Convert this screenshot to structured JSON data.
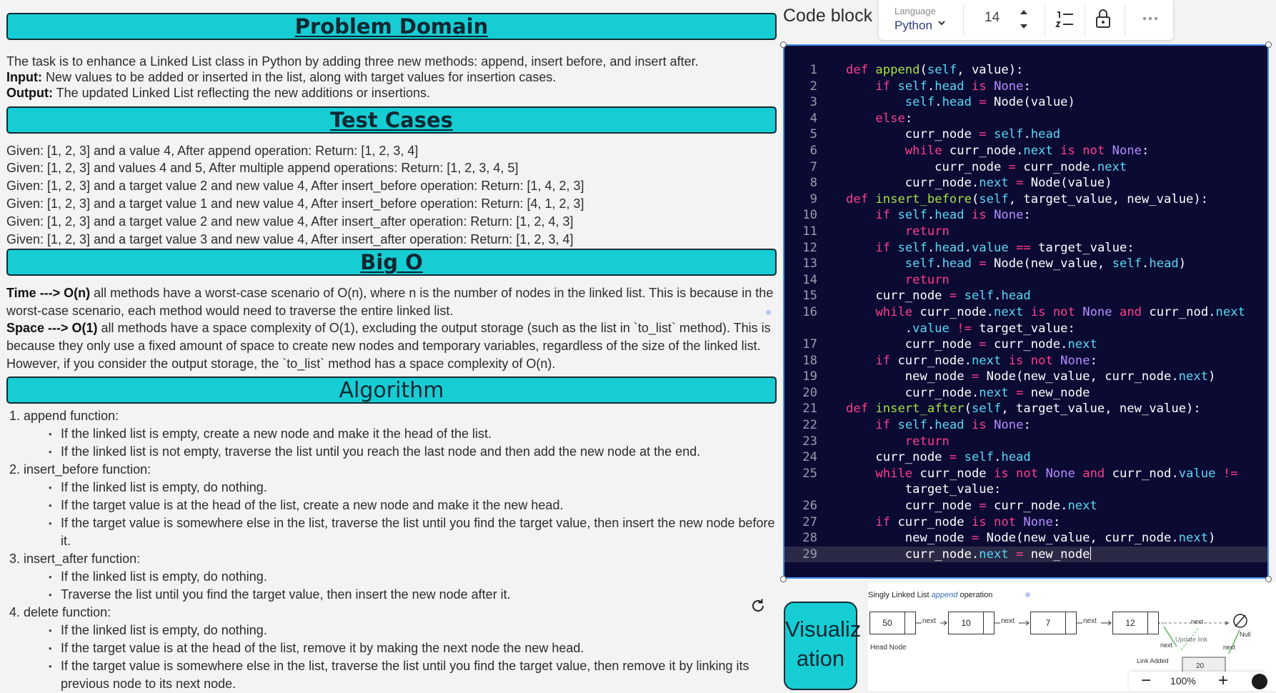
{
  "sections": {
    "problem_domain": {
      "title": "Problem Domain",
      "description": "The task is to enhance a Linked List class in Python by adding three new methods: append, insert before, and insert after.",
      "input_label": "Input:",
      "input_text": " New values to be added or inserted in the list, along with target values for insertion cases.",
      "output_label": "Output:",
      "output_text": " The updated Linked List reflecting the new additions or insertions."
    },
    "test_cases": {
      "title": "Test Cases",
      "items": [
        "Given: [1, 2, 3] and a value 4, After append operation: Return: [1, 2, 3, 4]",
        "Given: [1, 2, 3] and values 4 and 5, After multiple append operations: Return: [1, 2, 3, 4, 5]",
        "Given: [1, 2, 3] and a target value 2 and new value 4, After insert_before operation: Return: [1, 4, 2, 3]",
        "Given: [1, 2, 3] and a target value 1 and new value 4, After insert_before operation: Return: [4, 1, 2, 3]",
        "Given: [1, 2, 3] and a target value 2 and new value 4, After insert_after operation: Return: [1, 2, 4, 3]",
        "Given: [1, 2, 3] and a target value 3 and new value 4, After insert_after operation: Return: [1, 2, 3, 4]"
      ]
    },
    "big_o": {
      "title": "Big O",
      "time_label": "Time ---> O(n)",
      "time_text": " all methods have a worst-case scenario of O(n), where n is the number of nodes in the linked list. This is because in the worst-case scenario, each method would need to traverse the entire linked list.",
      "space_label": "Space ---> O(1)",
      "space_text": " all methods have a space complexity of O(1), excluding the output storage (such as the list in `to_list` method). This is because they only use a fixed amount of space to create new nodes and temporary variables, regardless of the size of the linked list. However, if you consider the output storage, the `to_list` method has a space complexity of O(n)."
    },
    "algorithm": {
      "title": "Algorithm",
      "items": [
        {
          "heading": "1. append function:",
          "bullets": [
            "If the linked list is empty, create a new node and make it the head of the list.",
            "If the linked list is not empty, traverse the list until you reach the last node and then add the new node at the end."
          ]
        },
        {
          "heading": "2. insert_before function:",
          "bullets": [
            "If the linked list is empty, do nothing.",
            "If the target value is at the head of the list, create a new node and make it the new head.",
            "If the target value is somewhere else in the list, traverse the list until you find the target value, then insert the new node before it."
          ]
        },
        {
          "heading": "3. insert_after function:",
          "bullets": [
            "If the linked list is empty, do nothing.",
            "Traverse the list until you find the target value, then insert the new node after it."
          ]
        },
        {
          "heading": "4. delete function:",
          "bullets": [
            "If the linked list is empty, do nothing.",
            "If the target value is at the head of the list, remove it by making the next node the new head.",
            "If the target value is somewhere else in the list, traverse the list until you find the target value, then remove it by linking its previous node to its next node."
          ]
        }
      ]
    }
  },
  "code_block": {
    "title": "Code block",
    "language_label": "Language",
    "language_value": "Python",
    "font_size": "14",
    "lines": [
      "def append(self, value):",
      "    if self.head is None:",
      "        self.head = Node(value)",
      "    else:",
      "        curr_node = self.head",
      "        while curr_node.next is not None:",
      "            curr_node = curr_node.next",
      "        curr_node.next = Node(value)",
      "def insert_before(self, target_value, new_value):",
      "    if self.head is None:",
      "        return",
      "    if self.head.value == target_value:",
      "        self.head = Node(new_value, self.head)",
      "        return",
      "    curr_node = self.head",
      "    while curr_node.next is not None and curr_nod.next",
      "        .value != target_value:",
      "        curr_node = curr_node.next",
      "    if curr_node.next is not None:",
      "        new_node = Node(new_value, curr_node.next)",
      "        curr_node.next = new_node",
      "def insert_after(self, target_value, new_value):",
      "    if self.head is None:",
      "        return",
      "    curr_node = self.head",
      "    while curr_node is not None and curr_nod.value !=",
      "        target_value:",
      "        curr_node = curr_node.next",
      "    if curr_node is not None:",
      "        new_node = Node(new_value, curr_node.next)",
      "        curr_node.next = new_node"
    ],
    "line_numbers": [
      "1",
      "2",
      "3",
      "4",
      "5",
      "6",
      "7",
      "8",
      "9",
      "10",
      "11",
      "12",
      "13",
      "14",
      "15",
      "16",
      "",
      "17",
      "18",
      "19",
      "20",
      "21",
      "22",
      "23",
      "24",
      "25",
      "",
      "26",
      "27",
      "28",
      "29"
    ]
  },
  "visualization": {
    "button_label": "Visualiz ation",
    "diagram_title_prefix": "Singly Linked List ",
    "diagram_title_emph": "append",
    "diagram_title_suffix": " operation",
    "nodes": [
      "50",
      "10",
      "7",
      "12"
    ],
    "next_label": "next",
    "head_label": "Head Node",
    "null_label": "Null",
    "update_link_label": "Update link",
    "link_added_label": "Link Added",
    "new_node_value": "20"
  },
  "zoom": {
    "level": "100%",
    "minus": "−",
    "plus": "+"
  }
}
